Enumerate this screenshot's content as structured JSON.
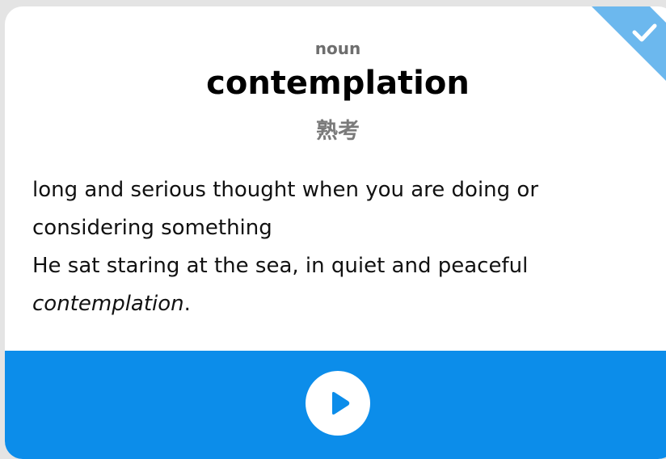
{
  "card": {
    "part_of_speech": "noun",
    "word": "contemplation",
    "translation": "熟考",
    "definition": "long and serious thought when you are doing or considering something",
    "example_before": "He sat staring at the sea, in quiet and peaceful ",
    "example_highlight": "contemplation",
    "example_after": ".",
    "status_icon": "check-icon",
    "play_icon": "play-icon"
  },
  "colors": {
    "accent": "#0c8dea",
    "corner_badge": "#6cb8ee",
    "pos_text": "#6e6e6e",
    "translation_text": "#7a7a7a"
  }
}
